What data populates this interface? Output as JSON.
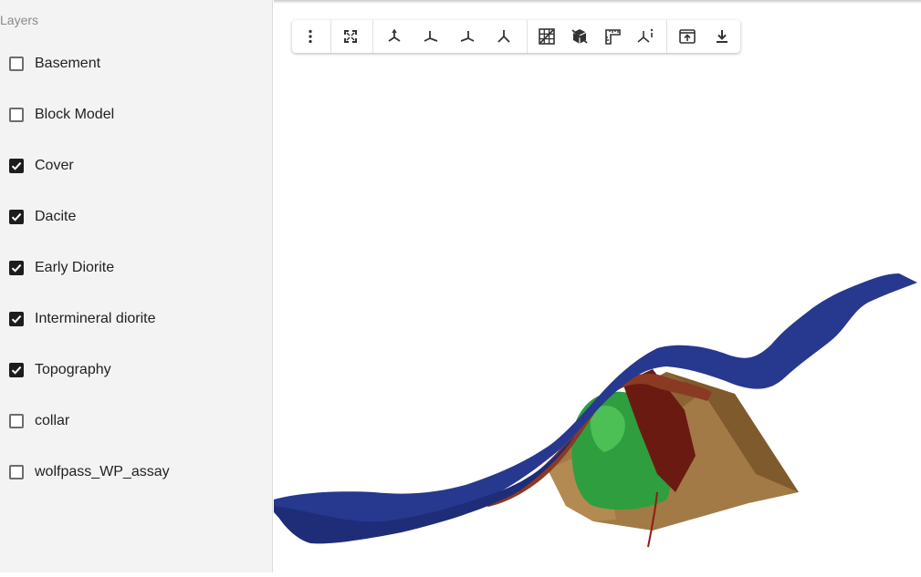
{
  "sidebar": {
    "title": "Layers",
    "layers": [
      {
        "label": "Basement",
        "checked": false
      },
      {
        "label": "Block Model",
        "checked": false
      },
      {
        "label": "Cover",
        "checked": true
      },
      {
        "label": "Dacite",
        "checked": true
      },
      {
        "label": "Early Diorite",
        "checked": true
      },
      {
        "label": "Intermineral diorite",
        "checked": true
      },
      {
        "label": "Topography",
        "checked": true
      },
      {
        "label": "collar",
        "checked": false
      },
      {
        "label": "wolfpass_WP_assay",
        "checked": false
      }
    ]
  },
  "toolbar": {
    "buttons": [
      {
        "icon": "more-vert-icon"
      },
      {
        "icon": "fit-view-icon"
      },
      {
        "icon": "axis-view-1-icon"
      },
      {
        "icon": "axis-view-2-icon"
      },
      {
        "icon": "axis-view-3-icon"
      },
      {
        "icon": "axis-view-4-icon"
      },
      {
        "icon": "grid-icon"
      },
      {
        "icon": "cube-icon"
      },
      {
        "icon": "ruler-icon"
      },
      {
        "icon": "axes-info-icon"
      },
      {
        "icon": "export-icon"
      },
      {
        "icon": "download-icon"
      }
    ]
  },
  "scene": {
    "colors": {
      "topography": "#27388f",
      "cover": "#8a3a22",
      "dacite": "#a27a45",
      "early_diorite": "#2f9e3f",
      "intermineral": "#6b1a12"
    }
  }
}
